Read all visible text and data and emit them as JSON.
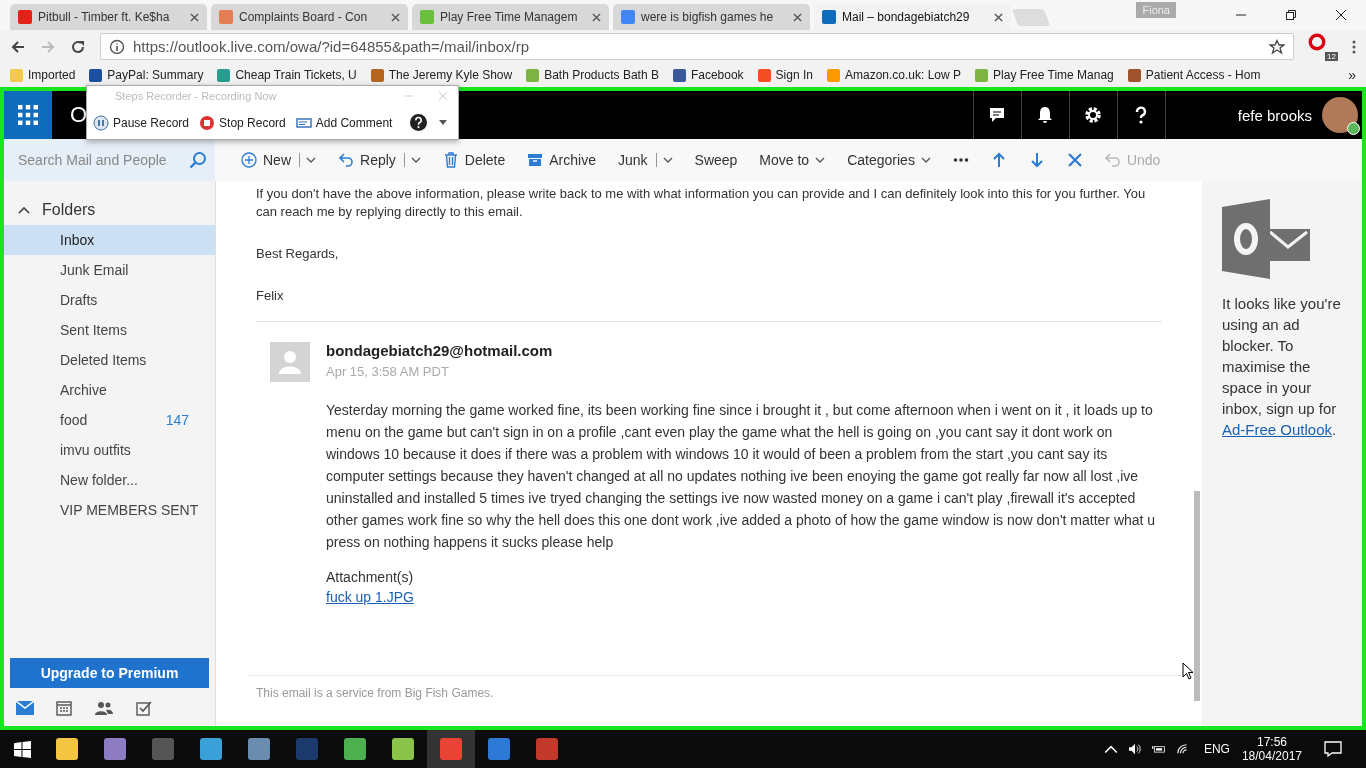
{
  "browser": {
    "tabs": [
      {
        "title": "Pitbull - Timber ft. Ke$ha",
        "selected": false
      },
      {
        "title": "Complaints Board - Con",
        "selected": false
      },
      {
        "title": "Play Free Time Managem",
        "selected": false
      },
      {
        "title": "were is bigfish games he",
        "selected": false
      },
      {
        "title": "Mail – bondagebiatch29",
        "selected": true
      }
    ],
    "profile": "Fiona",
    "url": "https://outlook.live.com/owa/?id=64855&path=/mail/inbox/rp",
    "extension_badge": "12",
    "bookmarks": [
      "Imported",
      "PayPal: Summary",
      "Cheap Train Tickets, U",
      "The Jeremy Kyle Show",
      "Bath Products Bath B",
      "Facebook",
      "Sign In",
      "Amazon.co.uk: Low P",
      "Play Free Time Manag",
      "Patient Access - Hom"
    ],
    "bookmarks_overflow": "»"
  },
  "steps_recorder": {
    "title": "Steps Recorder - Recording Now",
    "buttons": [
      "Pause Record",
      "Stop Record",
      "Add Comment"
    ]
  },
  "outlook": {
    "app_title_fragment": "O",
    "user_name": "fefe brooks",
    "search": {
      "placeholder": "Search Mail and People"
    },
    "toolbar": [
      {
        "kind": "split",
        "label": "New",
        "disabled": false
      },
      {
        "kind": "split",
        "label": "Reply",
        "disabled": false
      },
      {
        "kind": "button",
        "label": "Delete",
        "disabled": false
      },
      {
        "kind": "button",
        "label": "Archive",
        "disabled": false
      },
      {
        "kind": "split",
        "label": "Junk",
        "disabled": false
      },
      {
        "kind": "button",
        "label": "Sweep",
        "disabled": false
      },
      {
        "kind": "menu",
        "label": "Move to",
        "disabled": false
      },
      {
        "kind": "menu",
        "label": "Categories",
        "disabled": false
      },
      {
        "kind": "icon",
        "disabled": false
      },
      {
        "kind": "icon",
        "disabled": false
      },
      {
        "kind": "icon",
        "disabled": false
      },
      {
        "kind": "icon",
        "disabled": false
      },
      {
        "kind": "button",
        "label": "Undo",
        "disabled": true
      }
    ],
    "folders_heading": "Folders",
    "folders": [
      {
        "name": "Inbox",
        "selected": true
      },
      {
        "name": "Junk Email",
        "selected": false
      },
      {
        "name": "Drafts",
        "selected": false
      },
      {
        "name": "Sent Items",
        "selected": false
      },
      {
        "name": "Deleted Items",
        "selected": false
      },
      {
        "name": "Archive",
        "selected": false
      },
      {
        "name": "food",
        "count": "147",
        "selected": false
      },
      {
        "name": "imvu outfits",
        "selected": false
      },
      {
        "name": "New folder...",
        "selected": false
      },
      {
        "name": "VIP MEMBERS SENT",
        "selected": false
      }
    ],
    "upgrade_button": "Upgrade to Premium",
    "message": {
      "previous_text": [
        "If you don't have the above information, please write back to me with what information you can provide and I can definitely look into this for you further. You can reach me by replying directly to this email.",
        "Best Regards,",
        "Felix"
      ],
      "sender": "bondagebiatch29@hotmail.com",
      "date": "Apr 15, 3:58 AM PDT",
      "body": "Yesterday morning the game worked fine, its been working fine since i brought it , but come afternoon when i went on it , it loads up to menu on the game but can't sign in on a profile ,cant even play the game what the hell is going on ,you cant say it dont work on windows 10 because it does if there was a problem with windows 10 it would of been a problem from the start ,you cant say its computer settings because they haven't changed at all no updates nothing ive been enoying the game got really far now all lost ,ive uninstalled and installed 5 times ive tryed changing the settings ive now wasted money on a game i can't play ,firewall it's accepted other games work fine so why the hell does this one dont work ,ive added a photo of how the game window is now don't matter what u press on nothing happens it sucks please help",
      "attachments_label": "Attachment(s)",
      "attachment": "fuck up 1.JPG",
      "footer": "This email is a service from Big Fish Games."
    },
    "ad_panel": {
      "text": "It looks like you're using an ad blocker. To maximise the space in your inbox, sign up for",
      "link": "Ad-Free Outlook",
      "after": "."
    }
  },
  "taskbar": {
    "language": "ENG",
    "time": "17:56",
    "date": "18/04/2017"
  }
}
